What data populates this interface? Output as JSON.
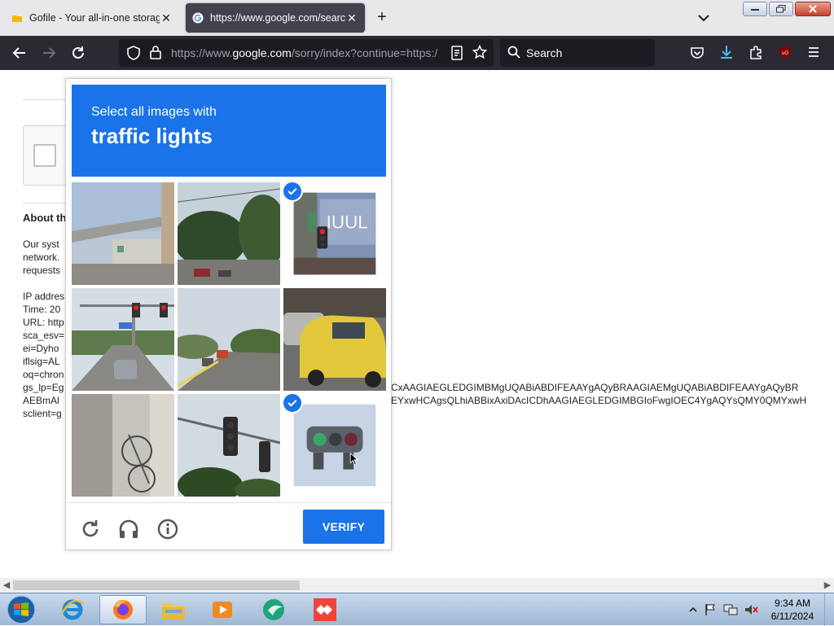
{
  "browser": {
    "tabs": [
      {
        "title": "Gofile - Your all-in-one storage",
        "active": false
      },
      {
        "title": "https://www.google.com/search",
        "active": true
      }
    ],
    "url": {
      "prefix": "https://www.",
      "domain": "google.com",
      "rest": "/sorry/index?continue=https:/"
    },
    "search_placeholder": "Search"
  },
  "background_page": {
    "heading": "About th",
    "paragraph": [
      "Our syst",
      "network.",
      "requests"
    ],
    "details": [
      "IP addres",
      "Time: 20",
      "URL: http",
      "sca_esv=",
      "ei=Dyho",
      "iflsig=AL",
      "oq=chron",
      "gs_lp=Eg",
      "AEBmAl",
      "sclient=g"
    ],
    "long_line_1": "CxAAGIAEGLEDGIMBMgUQABiABDIFEAAYgAQyBRAAGIAEMgUQABiABDIFEAAYgAQyBR",
    "long_line_2": "EYxwHCAgsQLhiABBixAxiDAcICDhAAGIAEGLEDGIMBGIoFwgIOEC4YgAQYsQMY0QMYxwH"
  },
  "captcha": {
    "instruction": "Select all images with",
    "target": "traffic lights",
    "tiles": [
      {
        "scene": "overpass street",
        "selected": false
      },
      {
        "scene": "trees intersection",
        "selected": false
      },
      {
        "scene": "traffic light storefront",
        "selected": true
      },
      {
        "scene": "road with traffic lights",
        "selected": false
      },
      {
        "scene": "road trees",
        "selected": false
      },
      {
        "scene": "yellow taxis",
        "selected": false
      },
      {
        "scene": "wall with bicycle",
        "selected": false
      },
      {
        "scene": "traffic light pole trees",
        "selected": false
      },
      {
        "scene": "traffic light closeup",
        "selected": true
      }
    ],
    "verify_label": "VERIFY",
    "footer_icons": [
      "reload-icon",
      "audio-icon",
      "info-icon"
    ]
  },
  "taskbar": {
    "time": "9:34 AM",
    "date": "6/11/2024"
  },
  "colors": {
    "accent": "#1a73e8",
    "toolbar": "#2b2a33"
  }
}
